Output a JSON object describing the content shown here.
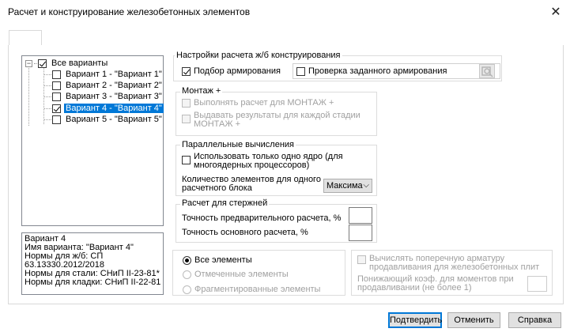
{
  "window": {
    "title": "Расчет и конструирование железобетонных элементов",
    "close_glyph": "✕"
  },
  "tree": {
    "root": {
      "label": "Все варианты",
      "checked": true,
      "expander": "−"
    },
    "items": [
      {
        "label": "Вариант 1 - \"Вариант 1\"",
        "checked": false,
        "selected": false
      },
      {
        "label": "Вариант 2 - \"Вариант 2\"",
        "checked": false,
        "selected": false
      },
      {
        "label": "Вариант 3 - \"Вариант 3\"",
        "checked": false,
        "selected": false
      },
      {
        "label": "Вариант 4 - \"Вариант 4\"",
        "checked": true,
        "selected": true
      },
      {
        "label": "Вариант 5 - \"Вариант 5\"",
        "checked": false,
        "selected": false
      }
    ]
  },
  "info": {
    "lines": [
      "Вариант 4",
      "Имя варианта: \"Вариант 4\"",
      "Нормы для ж/б: СП",
      "63.13330.2012/2018",
      "Нормы для стали: СНиП II-23-81*",
      "Нормы для кладки: СНиП II-22-81"
    ]
  },
  "settings": {
    "title": "Настройки расчета ж/б конструирования",
    "select_reinforcement": {
      "label": "Подбор армирования",
      "checked": true
    },
    "check_reinforcement": {
      "label": "Проверка заданного армирования",
      "checked": false
    },
    "settings_icon": "settings-disabled-icon"
  },
  "montage": {
    "title": "Монтаж +",
    "option1": {
      "label": "Выполнять расчет для МОНТАЖ +",
      "checked": false,
      "enabled": false
    },
    "option2": {
      "line1": "Выдавать результаты для каждой стадии",
      "line2": "МОНТАЖ +",
      "checked": false,
      "enabled": false
    }
  },
  "parallel": {
    "title": "Параллельные вычисления",
    "single_core": {
      "line1": "Использовать только одно ядро (для",
      "line2": "многоядерных процессоров)",
      "checked": false
    },
    "count_label_line1": "Количество элементов для одного",
    "count_label_line2": "расчетного блока",
    "count_value": "Максима",
    "dropdown_arrow": "⌵"
  },
  "rods": {
    "title": "Расчет для стержней",
    "prelim_label": "Точность предварительного расчета, %",
    "main_label": "Точность основного расчета, %",
    "prelim_value": "",
    "main_value": ""
  },
  "elements": {
    "options": [
      {
        "label": "Все элементы",
        "checked": true,
        "enabled": true
      },
      {
        "label": "Отмеченные элементы",
        "checked": false,
        "enabled": false
      },
      {
        "label": "Фрагментированные элементы",
        "checked": false,
        "enabled": false
      }
    ]
  },
  "punching": {
    "checkbox_line1": "Вычислять поперечную арматуру",
    "checkbox_line2": "продавливания для железобетонных плит",
    "coef_line1": "Понижающий коэф. для моментов при",
    "coef_line2": "продавливании (не более 1)",
    "coef_value": ""
  },
  "buttons": {
    "ok": "Подтвердить",
    "cancel": "Отменить",
    "help": "Справка"
  }
}
